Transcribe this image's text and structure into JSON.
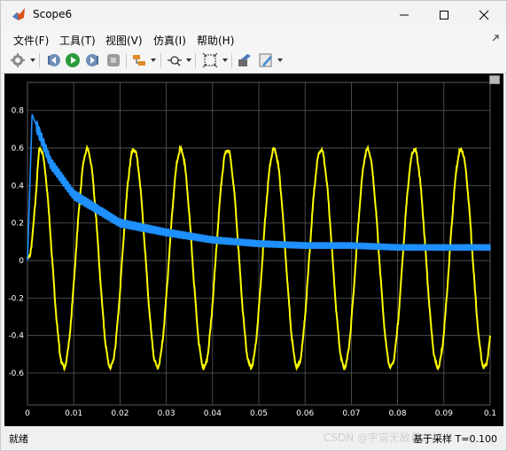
{
  "window": {
    "title": "Scope6",
    "icons": {
      "app": "matlab-icon",
      "minimize": "minimize-icon",
      "maximize": "maximize-icon",
      "close": "close-icon"
    }
  },
  "menu": [
    {
      "label": "文件(F)"
    },
    {
      "label": "工具(T)"
    },
    {
      "label": "视图(V)"
    },
    {
      "label": "仿真(I)"
    },
    {
      "label": "帮助(H)"
    }
  ],
  "toolbar": {
    "icons": [
      "settings-icon",
      "step-back-icon",
      "run-icon",
      "step-forward-icon",
      "stop-icon",
      "highlight-icon",
      "zoom-icon",
      "fit-icon",
      "write-icon",
      "style-icon"
    ]
  },
  "chart_data": {
    "type": "line",
    "x_ticks": [
      "0",
      "0.01",
      "0.02",
      "0.03",
      "0.04",
      "0.05",
      "0.06",
      "0.07",
      "0.08",
      "0.09",
      "0.1"
    ],
    "y_ticks": [
      "0.8",
      "0.6",
      "0.4",
      "0.2",
      "0",
      "-0.2",
      "-0.4",
      "-0.6"
    ],
    "xlim": [
      0,
      0.1
    ],
    "ylim": [
      -0.77,
      0.95
    ],
    "grid": true,
    "series": [
      {
        "color": "#ffff00",
        "description": "sinusoid",
        "frequency_hz": 99,
        "amplitude": 0.58,
        "phase_deg": -10
      },
      {
        "color": "#1e90ff",
        "description": "decaying noisy trace",
        "x": [
          0,
          0.001,
          0.005,
          0.01,
          0.02,
          0.03,
          0.04,
          0.05,
          0.06,
          0.07,
          0.08,
          0.09,
          0.1
        ],
        "y": [
          0.0,
          0.78,
          0.52,
          0.35,
          0.2,
          0.15,
          0.11,
          0.09,
          0.08,
          0.08,
          0.07,
          0.07,
          0.07
        ]
      }
    ],
    "colors": {
      "background": "#000000",
      "grid": "#5a5a5a",
      "axis_text": "#ffffff"
    }
  },
  "status": {
    "left": "就绪",
    "right": "基于采样  T=0.100"
  },
  "watermark": "CSDN @宇宙无敌暴龙战士"
}
